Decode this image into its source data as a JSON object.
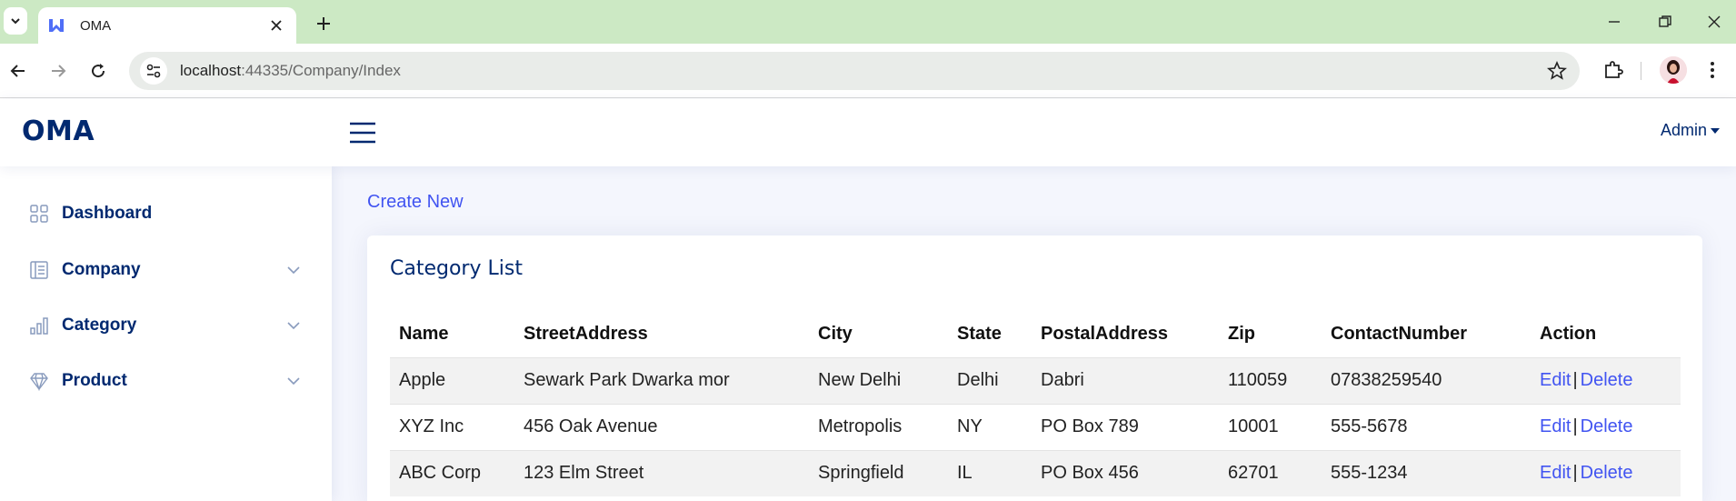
{
  "browser": {
    "tab_title": "OMA",
    "url_host": "localhost",
    "url_rest": ":44335/Company/Index"
  },
  "header": {
    "logo": "OMA",
    "user_menu": "Admin"
  },
  "sidebar": {
    "items": [
      {
        "label": "Dashboard",
        "icon": "grid-icon",
        "expandable": false
      },
      {
        "label": "Company",
        "icon": "layout-icon",
        "expandable": true
      },
      {
        "label": "Category",
        "icon": "bar-chart-icon",
        "expandable": true
      },
      {
        "label": "Product",
        "icon": "gem-icon",
        "expandable": true
      }
    ]
  },
  "main": {
    "create_link": "Create New",
    "card_title": "Category List",
    "columns": [
      "Name",
      "StreetAddress",
      "City",
      "State",
      "PostalAddress",
      "Zip",
      "ContactNumber",
      "Action"
    ],
    "rows": [
      [
        "Apple",
        "Sewark Park Dwarka mor",
        "New Delhi",
        "Delhi",
        "Dabri",
        "110059",
        "07838259540"
      ],
      [
        "XYZ Inc",
        "456 Oak Avenue",
        "Metropolis",
        "NY",
        "PO Box 789",
        "10001",
        "555-5678"
      ],
      [
        "ABC Corp",
        "123 Elm Street",
        "Springfield",
        "IL",
        "PO Box 456",
        "62701",
        "555-1234"
      ]
    ],
    "edit_label": "Edit",
    "delete_label": "Delete",
    "action_separator": "|"
  },
  "colors": {
    "tabstrip": "#cce9c4",
    "brand": "#012970",
    "link": "#4154f1",
    "main_bg": "#f4f6fd"
  }
}
